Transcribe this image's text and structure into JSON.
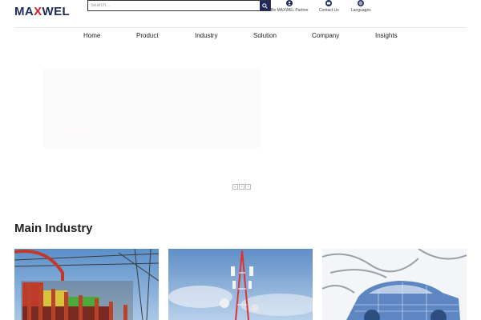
{
  "header": {
    "logo": {
      "pre": "MA",
      "x": "X",
      "post": "WEL"
    },
    "search": {
      "placeholder": "Search..."
    },
    "links": [
      {
        "label": "Be MAXWEL Partner",
        "icon": "user-icon"
      },
      {
        "label": "Contact Us",
        "icon": "chat-icon"
      },
      {
        "label": "Languages",
        "icon": "globe-icon"
      }
    ]
  },
  "nav": {
    "items": [
      "Home",
      "Product",
      "Industry",
      "Solution",
      "Company",
      "Insights"
    ]
  },
  "carousel": {
    "slides": 3
  },
  "main": {
    "section_title": "Main Industry",
    "cards": [
      {
        "name": "power-substation-image"
      },
      {
        "name": "telecom-tower-image"
      },
      {
        "name": "automotive-wireframe-image"
      }
    ]
  },
  "colors": {
    "brand": "#1f2a5c",
    "accent": "#d6202a"
  }
}
